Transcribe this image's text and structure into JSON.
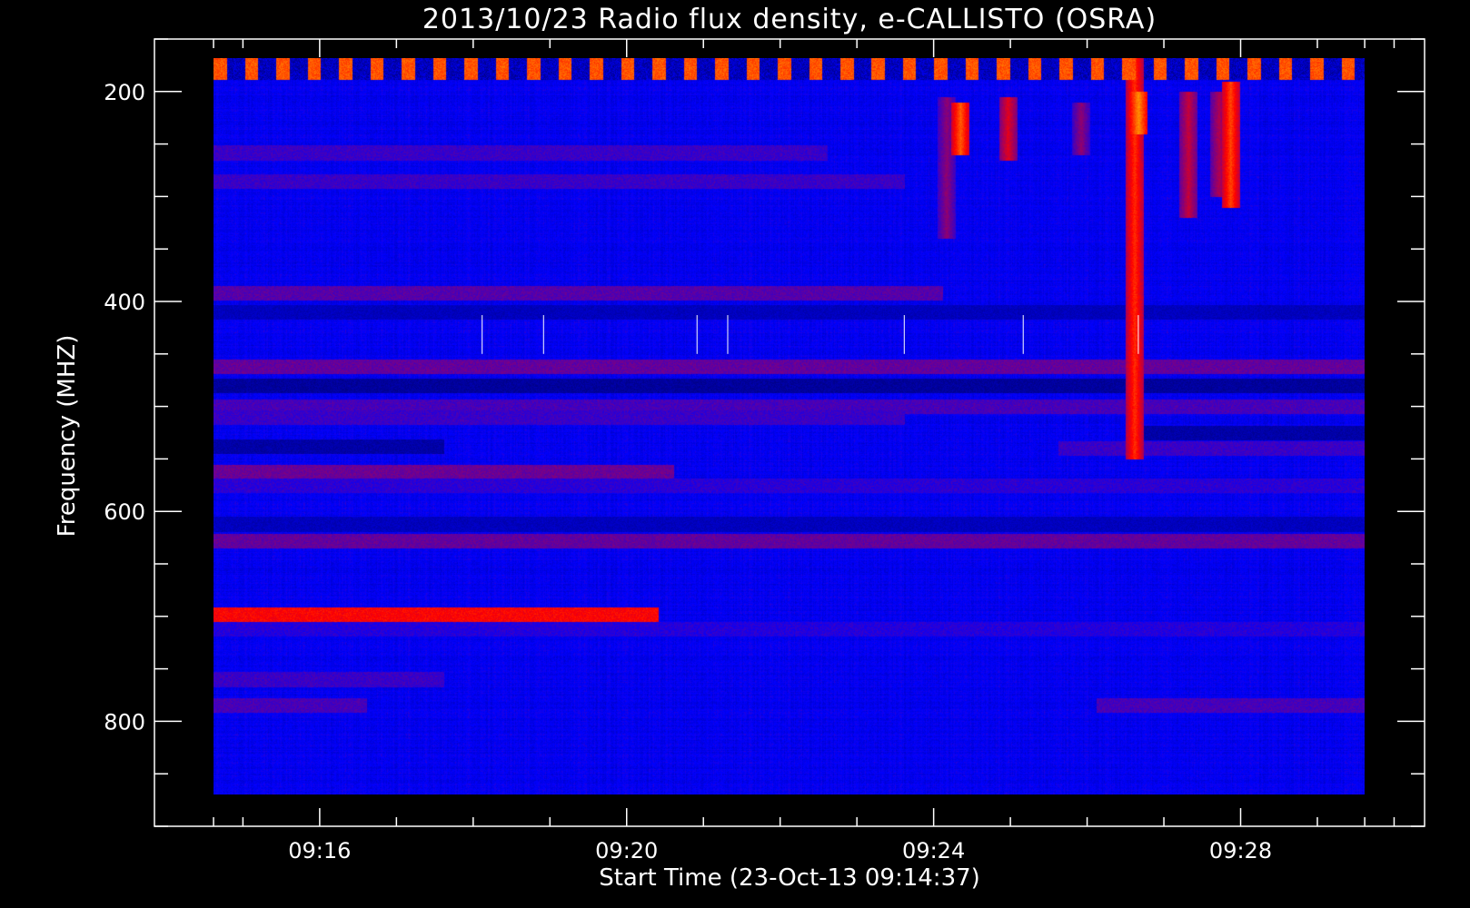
{
  "chart_data": {
    "type": "heatmap",
    "title": "2013/10/23  Radio flux density, e-CALLISTO (OSRA)",
    "xlabel": "Start Time (23-Oct-13 09:14:37)",
    "ylabel": "Frequency (MHZ)",
    "x_tick_labels": [
      "09:16",
      "09:20",
      "09:24",
      "09:28"
    ],
    "x_tick_minutes": [
      1.383,
      5.383,
      9.383,
      13.383
    ],
    "xlim_minutes": [
      -0.77,
      15.78
    ],
    "y_tick_labels": [
      "200",
      "400",
      "600",
      "800"
    ],
    "y_tick_values": [
      200,
      400,
      600,
      800
    ],
    "ylim_mhz": [
      150,
      900
    ],
    "data_extent": {
      "time_minutes": [
        0,
        15.0
      ],
      "freq_mhz": [
        168,
        870
      ]
    },
    "y_inverted": true,
    "colormap": [
      "#000000",
      "#0000ff",
      "#ff0000",
      "#ffff00"
    ],
    "background_level": 0.28,
    "band_levels": [
      {
        "f": 178,
        "t0": 0.0,
        "t1": 15.0,
        "level": 0.55
      },
      {
        "f": 258,
        "t0": 0.0,
        "t1": 8.0,
        "level": 0.38
      },
      {
        "f": 285,
        "t0": 0.0,
        "t1": 9.0,
        "level": 0.38
      },
      {
        "f": 392,
        "t0": 0.0,
        "t1": 9.5,
        "level": 0.42
      },
      {
        "f": 410,
        "t0": 0.0,
        "t1": 15.0,
        "level": 0.18
      },
      {
        "f": 462,
        "t0": 0.0,
        "t1": 15.0,
        "level": 0.44
      },
      {
        "f": 480,
        "t0": 0.0,
        "t1": 15.0,
        "level": 0.12
      },
      {
        "f": 500,
        "t0": 0.0,
        "t1": 15.0,
        "level": 0.4
      },
      {
        "f": 510,
        "t0": 0.0,
        "t1": 9.0,
        "level": 0.38
      },
      {
        "f": 538,
        "t0": 0.0,
        "t1": 3.0,
        "level": 0.14
      },
      {
        "f": 562,
        "t0": 0.0,
        "t1": 6.0,
        "level": 0.45
      },
      {
        "f": 575,
        "t0": 0.0,
        "t1": 15.0,
        "level": 0.36
      },
      {
        "f": 612,
        "t0": 0.0,
        "t1": 15.0,
        "level": 0.18
      },
      {
        "f": 628,
        "t0": 0.0,
        "t1": 15.0,
        "level": 0.44
      },
      {
        "f": 698,
        "t0": 0.0,
        "t1": 5.8,
        "level": 0.66
      },
      {
        "f": 712,
        "t0": 0.0,
        "t1": 15.0,
        "level": 0.35
      },
      {
        "f": 760,
        "t0": 0.0,
        "t1": 3.0,
        "level": 0.38
      },
      {
        "f": 785,
        "t0": 0.0,
        "t1": 2.0,
        "level": 0.4
      },
      {
        "f": 785,
        "t0": 11.5,
        "t1": 15.0,
        "level": 0.4
      },
      {
        "f": 525,
        "t0": 12.0,
        "t1": 15.0,
        "level": 0.14
      },
      {
        "f": 540,
        "t0": 11.0,
        "t1": 15.0,
        "level": 0.38
      }
    ],
    "burst_events": [
      {
        "t": 9.73,
        "f0": 210,
        "f1": 260,
        "level": 0.78
      },
      {
        "t": 9.55,
        "f0": 205,
        "f1": 340,
        "level": 0.5
      },
      {
        "t": 10.35,
        "f0": 205,
        "f1": 265,
        "level": 0.62
      },
      {
        "t": 11.3,
        "f0": 210,
        "f1": 260,
        "level": 0.5
      },
      {
        "t": 12.0,
        "f0": 168,
        "f1": 550,
        "level": 0.72
      },
      {
        "t": 12.05,
        "f0": 200,
        "f1": 240,
        "level": 0.85
      },
      {
        "t": 12.7,
        "f0": 200,
        "f1": 320,
        "level": 0.58
      },
      {
        "t": 13.1,
        "f0": 200,
        "f1": 300,
        "level": 0.55
      },
      {
        "t": 13.25,
        "f0": 190,
        "f1": 310,
        "level": 0.75
      }
    ],
    "spikes_minutes": [
      3.5,
      4.3,
      6.3,
      6.7,
      9.0,
      10.55,
      12.05
    ]
  }
}
